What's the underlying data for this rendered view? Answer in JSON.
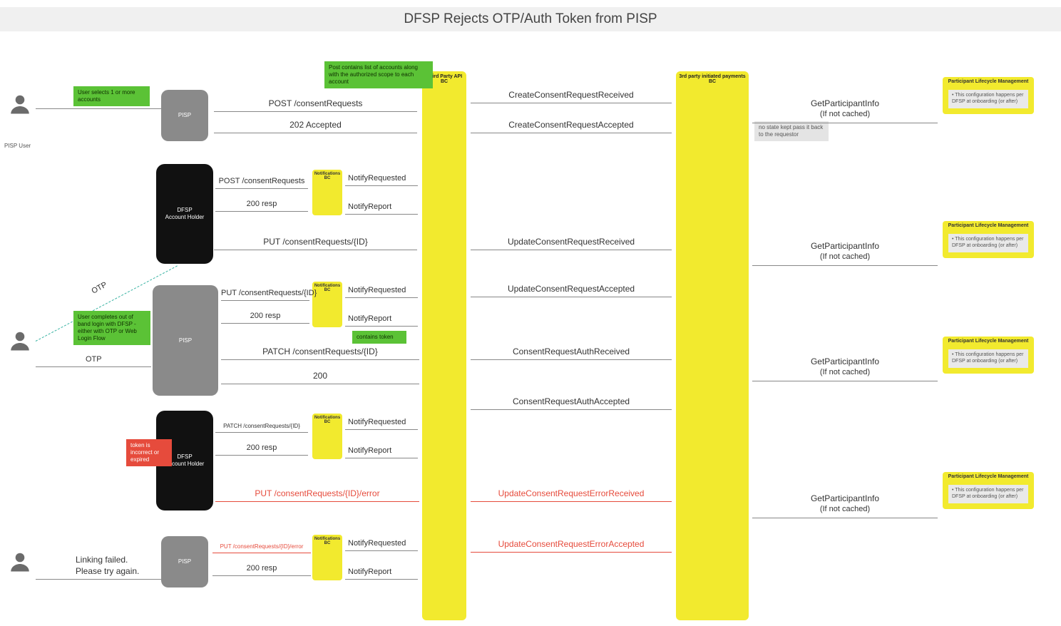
{
  "title": "DFSP Rejects OTP/Auth Token from PISP",
  "actors": {
    "pisp_user": "PISP User",
    "pisp": "PISP",
    "dfsp": "DFSP\nAccount Holder",
    "tp_api_bc": "Third Party API BC",
    "tpip_bc": "3rd party initiated payments BC",
    "notif_bc": "Notifications BC",
    "lifecycle": "Participant Lifecycle\nManagement"
  },
  "notes": {
    "select_accounts": "User selects 1 or more accounts",
    "post_accounts": "Post contains list of accounts along with the authorized scope to each account",
    "no_state": "no state kept\npass it back to the requestor",
    "complete_oob": "User completes out of band login with DFSP - either with OTP or Web Login Flow",
    "contains_token": "contains token",
    "token_bad": "token is incorrect or expired",
    "lifecycle_cfg": "This configuration happens per DFSP at onboarding (or after)"
  },
  "labels": {
    "otp": "OTP",
    "link_fail_1": "Linking failed.",
    "link_fail_2": "Please try again."
  },
  "msgs": {
    "post_cr": "POST /consentRequests",
    "accepted_202": "202 Accepted",
    "resp_200": "200 resp",
    "resp_200_plain": "200",
    "put_cr": "PUT /consentRequests/{ID}",
    "patch_cr": "PATCH /consentRequests/{ID}",
    "put_cr_err": "PUT /consentRequests/{ID}/error",
    "put_cr_err_short": "PUT /consentRequests/{ID}/error",
    "gpi": "GetParticipantInfo",
    "gpi_sub": "(If not cached)",
    "notify_req": "NotifyRequested",
    "notify_rep": "NotifyReport",
    "ev_ccr_recv": "CreateConsentRequestReceived",
    "ev_ccr_acc": "CreateConsentRequestAccepted",
    "ev_ucr_recv": "UpdateConsentRequestReceived",
    "ev_ucr_acc": "UpdateConsentRequestAccepted",
    "ev_cra_recv": "ConsentRequestAuthReceived",
    "ev_cra_acc": "ConsentRequestAuthAccepted",
    "ev_ucre_recv": "UpdateConsentRequestErrorReceived",
    "ev_ucre_acc": "UpdateConsentRequestErrorAccepted"
  }
}
